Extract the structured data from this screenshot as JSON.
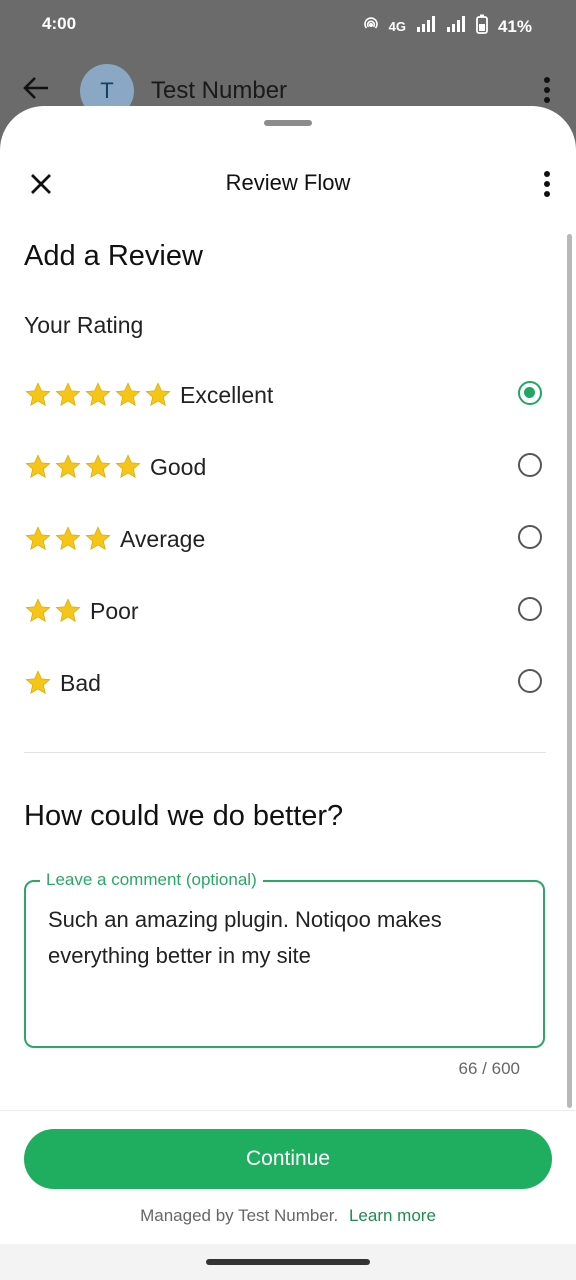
{
  "status_bar": {
    "time": "4:00",
    "network": "4G",
    "battery": "41%"
  },
  "chat_header": {
    "avatar_initial": "T",
    "name": "Test Number"
  },
  "sheet": {
    "title": "Review Flow",
    "heading": "Add a Review",
    "rating_label": "Your Rating",
    "options": [
      {
        "label": "Excellent",
        "stars": 5,
        "selected": true
      },
      {
        "label": "Good",
        "stars": 4,
        "selected": false
      },
      {
        "label": "Average",
        "stars": 3,
        "selected": false
      },
      {
        "label": "Poor",
        "stars": 2,
        "selected": false
      },
      {
        "label": "Bad",
        "stars": 1,
        "selected": false
      }
    ],
    "improve_heading": "How could we do better?",
    "comment": {
      "label": "Leave a comment (optional)",
      "value": "Such an amazing plugin. Notiqoo makes everything better in my site",
      "counter": "66 / 600"
    },
    "continue_label": "Continue",
    "managed_text": "Managed by Test Number.",
    "learn_more": "Learn more"
  },
  "colors": {
    "accent": "#1fae60",
    "star": "#f5c518"
  }
}
